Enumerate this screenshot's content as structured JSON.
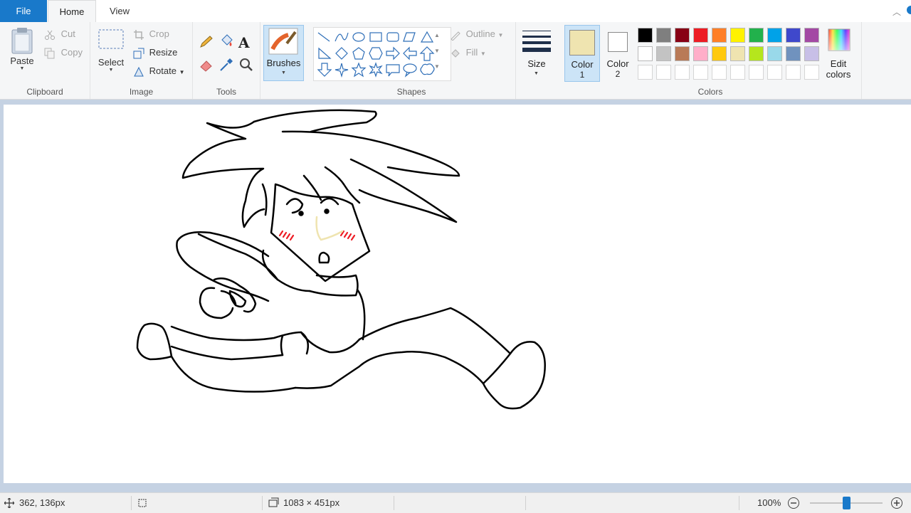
{
  "tabs": {
    "file": "File",
    "home": "Home",
    "view": "View"
  },
  "clipboard": {
    "paste": "Paste",
    "cut": "Cut",
    "copy": "Copy",
    "group": "Clipboard"
  },
  "image": {
    "select": "Select",
    "crop": "Crop",
    "resize": "Resize",
    "rotate": "Rotate",
    "group": "Image"
  },
  "tools": {
    "group": "Tools",
    "text_tool": "A"
  },
  "brushes": {
    "label": "Brushes"
  },
  "shapes": {
    "outline": "Outline",
    "fill": "Fill",
    "group": "Shapes"
  },
  "size": {
    "label": "Size"
  },
  "color1": {
    "label1": "Color",
    "label2": "1",
    "value": "#efe4b0"
  },
  "color2": {
    "label1": "Color",
    "label2": "2",
    "value": "#ffffff"
  },
  "colors": {
    "group": "Colors",
    "edit1": "Edit",
    "edit2": "colors",
    "row1": [
      "#000000",
      "#7f7f7f",
      "#880015",
      "#ed1c24",
      "#ff7f27",
      "#fff200",
      "#22b14c",
      "#00a2e8",
      "#3f48cc",
      "#a349a4"
    ],
    "row2": [
      "#ffffff",
      "#c3c3c3",
      "#b97a57",
      "#ffaec9",
      "#ffc90e",
      "#efe4b0",
      "#b5e61d",
      "#99d9ea",
      "#7092be",
      "#c8bfe7"
    ]
  },
  "status": {
    "cursor_pos": "362, 136px",
    "canvas_size": "1083 × 451px",
    "zoom": "100%",
    "zoom_level": 0.5
  }
}
